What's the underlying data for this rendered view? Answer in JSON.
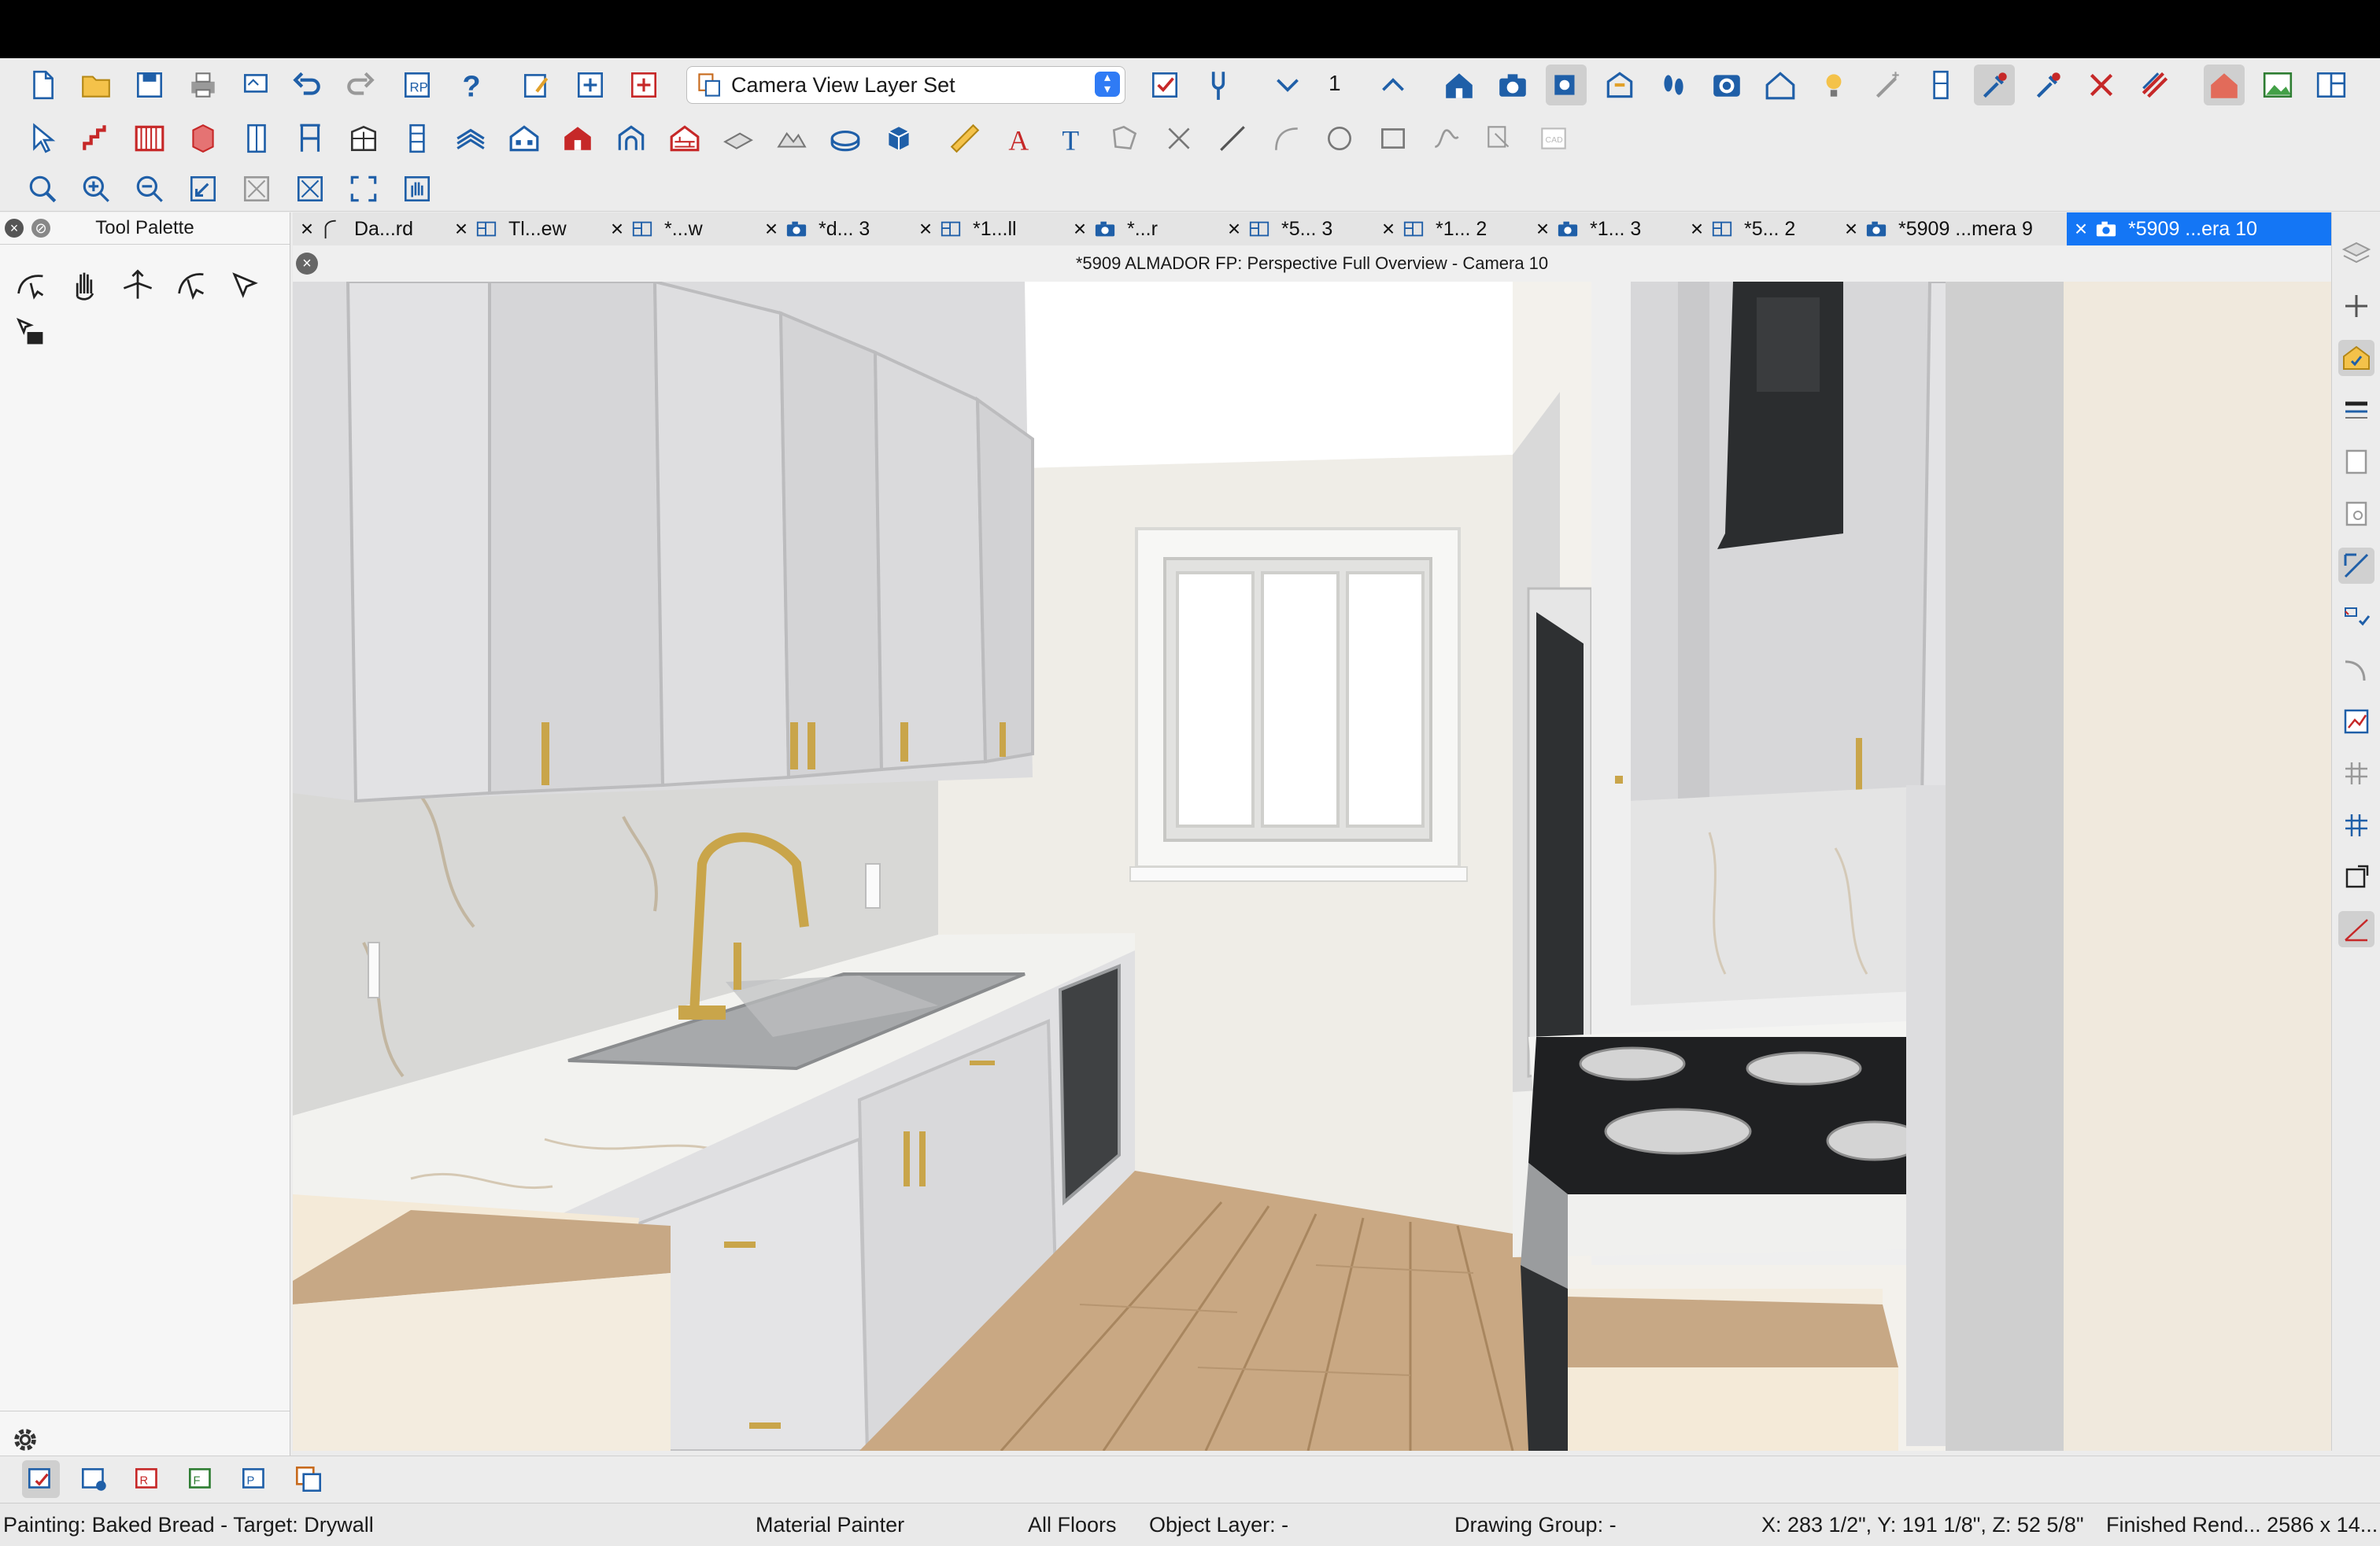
{
  "toolbar1": {
    "layer_set": "Camera View Layer Set",
    "floor_number": "1",
    "tools": [
      "new-file",
      "open-folder",
      "save",
      "print",
      "print-preview",
      "undo",
      "redo",
      "plot",
      "help",
      "edit-view",
      "send-to-layout",
      "send-3d",
      "layer-set",
      "layer-checkbox",
      "wrench",
      "chevron-down",
      "chevron-up",
      "house",
      "camera",
      "camera-3d",
      "elevation",
      "footprints",
      "camera-circle",
      "house-outline",
      "lightbulb",
      "wand",
      "tall-cabinet",
      "eyedropper",
      "eyedropper-2",
      "no-eyedropper",
      "material-stripe",
      "render-house",
      "image",
      "window-panels"
    ]
  },
  "toolbar2": {
    "tools": [
      "select-arrow",
      "stair-tool",
      "wall-tool",
      "cabinet-tool",
      "door-tool",
      "frame-tool",
      "cabinet-outline",
      "furniture",
      "roof-tool",
      "house-red",
      "arch-tool",
      "brick-house",
      "slab",
      "terrain",
      "ellipse-slab",
      "block-3d",
      "ruler",
      "text-a",
      "text-t",
      "polyline",
      "x-tool",
      "line-tool",
      "arc-tool",
      "circle-tool",
      "rect-tool",
      "spline-tool",
      "cad-tool",
      "cad-block"
    ]
  },
  "toolbar3": {
    "tools": [
      "zoom-window",
      "zoom-in",
      "zoom-out",
      "undo-zoom",
      "fill-window",
      "fill-window-all",
      "full-screen",
      "pan-hand"
    ]
  },
  "palette": {
    "title": "Tool Palette",
    "tools": [
      "orbit-tool",
      "pan-tool",
      "move-tool",
      "tilt-tool",
      "pointer-tool",
      "camera-move"
    ]
  },
  "tabs": [
    {
      "label": "Da...rd",
      "icon": "elevation-icon"
    },
    {
      "label": "Tl...ew",
      "icon": "plan-icon"
    },
    {
      "label": "*...w",
      "icon": "plan-icon"
    },
    {
      "label": "*d... 3",
      "icon": "camera-icon"
    },
    {
      "label": "*1...ll",
      "icon": "plan-icon"
    },
    {
      "label": "*...r",
      "icon": "camera-icon"
    },
    {
      "label": "*5... 3",
      "icon": "plan-icon"
    },
    {
      "label": "*1... 2",
      "icon": "plan-icon"
    },
    {
      "label": "*1... 3",
      "icon": "camera-icon"
    },
    {
      "label": "*5... 2",
      "icon": "plan-icon"
    },
    {
      "label": "*5909 ...mera 9",
      "icon": "camera-icon"
    },
    {
      "label": "*5909 ...era 10",
      "icon": "camera-icon",
      "active": true
    }
  ],
  "view": {
    "title": "*5909 ALMADOR FP: Perspective Full Overview - Camera 10"
  },
  "status": {
    "painting": "Painting: Baked Bread - Target: Drywall",
    "mode": "Material Painter",
    "floors": "All Floors",
    "object_layer": "Object Layer: -",
    "drawing_group": "Drawing Group: -",
    "coords": "X: 283 1/2\", Y: 191 1/8\", Z: 52 5/8\"",
    "render": "Finished Rend...  2586 x 14..."
  },
  "colors": {
    "accent": "#1476f5",
    "cabinet": "#d9d9db",
    "wood": "#c7a885",
    "counter": "#f2f2ef"
  }
}
